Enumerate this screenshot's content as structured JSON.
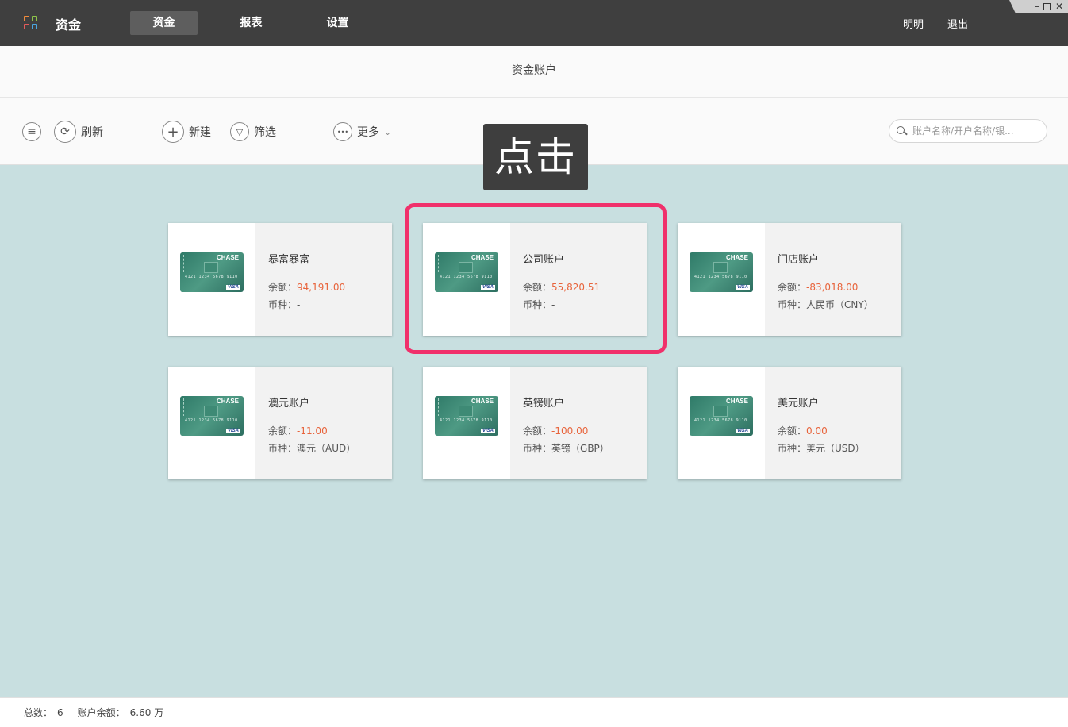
{
  "app": {
    "title": "资金",
    "logo_icon": "grid-logo-icon"
  },
  "nav": {
    "tabs": [
      {
        "label": "资金",
        "active": true
      },
      {
        "label": "报表",
        "active": false
      },
      {
        "label": "设置",
        "active": false
      }
    ],
    "user": "明明",
    "logout": "退出"
  },
  "window_controls": {
    "minimize": "–",
    "close": "✕"
  },
  "page": {
    "title": "资金账户"
  },
  "toolbar": {
    "menu_icon": "≡",
    "refresh_icon": "⟳",
    "refresh_label": "刷新",
    "new_icon": "+",
    "new_label": "新建",
    "filter_icon": "▽",
    "filter_label": "筛选",
    "more_icon": "•••",
    "more_label": "更多",
    "more_chevron": "⌄",
    "search_placeholder": "账户名称/开户名称/银..."
  },
  "tooltip": {
    "text": "点击"
  },
  "card_labels": {
    "balance": "余额：",
    "currency": "币种：",
    "card_brand": "CHASE",
    "card_network": "VISA",
    "card_number": "4121 1234 5678 9110"
  },
  "accounts": [
    {
      "name": "暴富暴富",
      "balance": "94,191.00",
      "currency": "-"
    },
    {
      "name": "公司账户",
      "balance": "55,820.51",
      "currency": "-"
    },
    {
      "name": "门店账户",
      "balance": "-83,018.00",
      "currency": "人民币（CNY）"
    },
    {
      "name": "澳元账户",
      "balance": "-11.00",
      "currency": "澳元（AUD）"
    },
    {
      "name": "英镑账户",
      "balance": "-100.00",
      "currency": "英镑（GBP）"
    },
    {
      "name": "美元账户",
      "balance": "0.00",
      "currency": "美元（USD）"
    }
  ],
  "footer": {
    "total_label": "总数：",
    "total_value": "6",
    "balance_label": "账户余额：",
    "balance_value": "6.60 万"
  },
  "colors": {
    "topbar": "#3f3f3f",
    "main_bg": "#c8dfe0",
    "highlight": "#f0306b",
    "balance_text": "#e8643c"
  }
}
